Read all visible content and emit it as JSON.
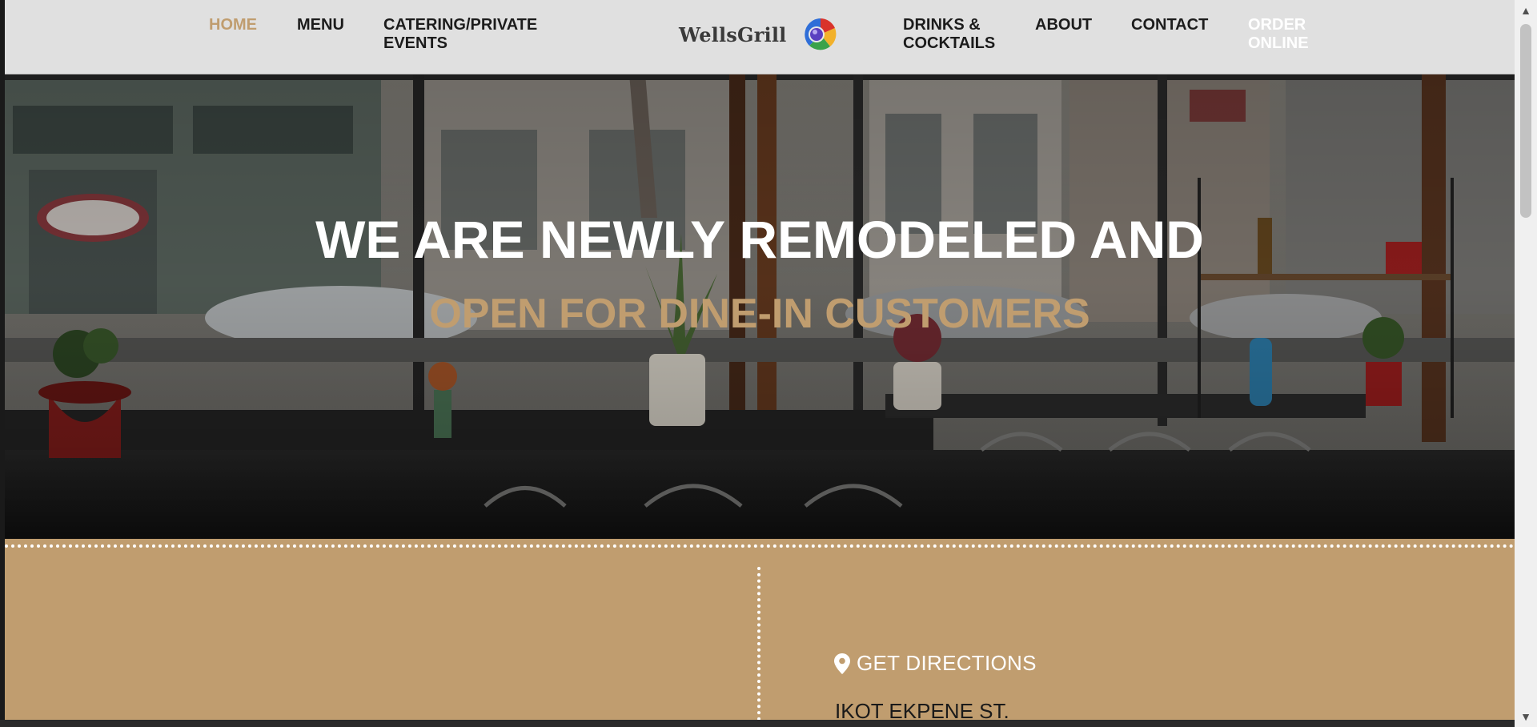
{
  "nav": {
    "home": "HOME",
    "menu": "MENU",
    "catering": "CATERING/PRIVATE\nEVENTS",
    "drinks": "DRINKS &\nCOCKTAILS",
    "about": "ABOUT",
    "contact": "CONTACT",
    "order": "ORDER\nONLINE"
  },
  "brand": {
    "name": "WellsGrill",
    "logo_icon": "sphere-logo-icon"
  },
  "hero": {
    "title": "WE ARE NEWLY REMODELED AND",
    "subtitle": "OPEN FOR DINE-IN CUSTOMERS"
  },
  "location": {
    "directions_label": "GET DIRECTIONS",
    "directions_icon": "map-pin-icon",
    "address": "IKOT EKPENE ST."
  },
  "colors": {
    "accent": "#c09d6f",
    "nav_background": "#e0e0e0",
    "nav_text": "#1c1c1c"
  }
}
